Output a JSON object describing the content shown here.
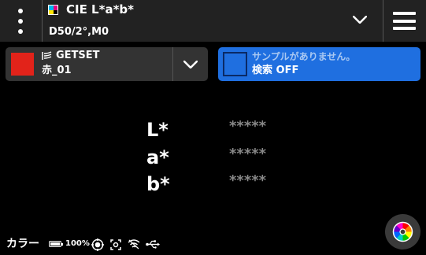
{
  "header": {
    "title": "CIE L*a*b*",
    "subtitle": "D50/2°,M0",
    "menu_icon": "kebab-menu-icon",
    "mode_icon": "cmyk-icon",
    "dropdown_icon": "chevron-down-icon",
    "nav_icon": "hamburger-menu-icon"
  },
  "target": {
    "mode_label": "GETSET",
    "color_name": "赤_01",
    "swatch_color": "#e2231a",
    "dropdown_icon": "chevron-down-icon"
  },
  "sample": {
    "message": "サンプルがありません。",
    "search_status": "検索 OFF",
    "swatch_color": "#1f6fe0"
  },
  "measurements": [
    {
      "label": "L*",
      "value": "*****"
    },
    {
      "label": "a*",
      "value": "*****"
    },
    {
      "label": "b*",
      "value": "*****"
    }
  ],
  "statusbar": {
    "mode": "カラー",
    "battery": "100%",
    "battery_level": 1.0,
    "icons": [
      "target-icon",
      "scan-icon",
      "wifi-icon",
      "usb-icon"
    ]
  },
  "fab": {
    "icon": "color-wheel-icon"
  }
}
